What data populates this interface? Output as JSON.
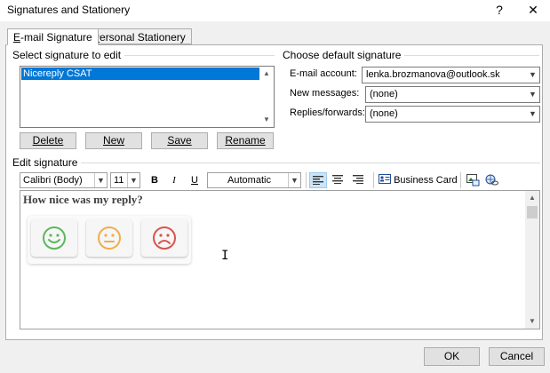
{
  "window": {
    "title": "Signatures and Stationery",
    "help_glyph": "?",
    "close_glyph": "✕"
  },
  "tabs": [
    {
      "label_accel": "E",
      "label_rest": "-mail Signature",
      "active": true
    },
    {
      "label_accel": "P",
      "label_rest": "ersonal Stationery",
      "active": false
    }
  ],
  "select_signature": {
    "label": "Select signature to edit",
    "items": [
      "Nicereply CSAT"
    ],
    "selected_index": 0
  },
  "signature_buttons": {
    "delete": "Delete",
    "new": "New",
    "save": "Save",
    "rename": "Rename"
  },
  "default_signature": {
    "label": "Choose default signature",
    "email_account_label": "E-mail account:",
    "email_account_value": "lenka.brozmanova@outlook.sk",
    "new_messages_label": "New messages:",
    "new_messages_value": "(none)",
    "replies_label": "Replies/forwards:",
    "replies_value": "(none)"
  },
  "edit_signature": {
    "label": "Edit signature",
    "font_name": "Calibri (Body)",
    "font_size": "11",
    "bold": "B",
    "italic": "I",
    "underline": "U",
    "color": "Automatic",
    "business_card_label": "Business Card",
    "content_heading": "How nice was my reply?",
    "faces": [
      {
        "name": "happy",
        "color": "#5cb85c"
      },
      {
        "name": "neutral",
        "color": "#f0ad4e"
      },
      {
        "name": "sad",
        "color": "#d9534f"
      }
    ]
  },
  "footer": {
    "ok": "OK",
    "cancel": "Cancel"
  }
}
